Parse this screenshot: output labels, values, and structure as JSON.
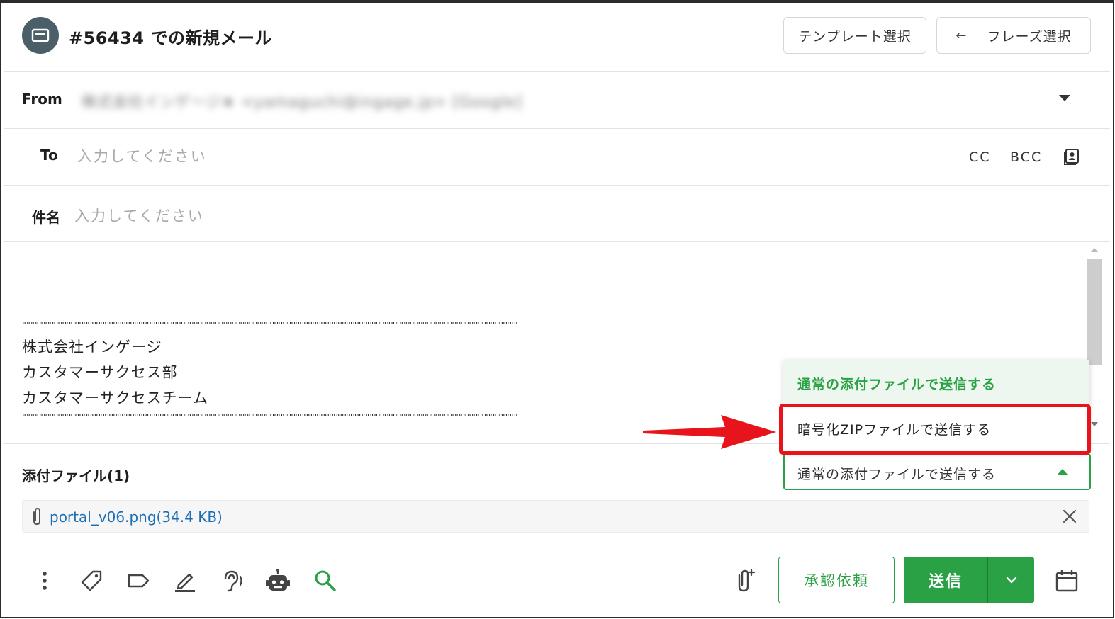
{
  "header": {
    "title": "#56434 での新規メール",
    "template_button": "テンプレート選択",
    "phrase_arrow": "←",
    "phrase_button": "フレーズ選択"
  },
  "from": {
    "label": "From",
    "value": "株式会社インゲージ★ <yamaguchi@ingage.jp> [Google]"
  },
  "to": {
    "label": "To",
    "placeholder": "入力してください",
    "cc": "CC",
    "bcc": "BCC"
  },
  "subject": {
    "label": "件名",
    "placeholder": "入力してください"
  },
  "body": {
    "separator": "\"\"\"\"\"\"\"\"\"\"\"\"\"\"\"\"\"\"\"\"\"\"\"\"\"\"\"\"\"\"\"\"\"\"\"\"\"\"\"\"\"\"\"\"\"\"\"\"\"\"\"\"\"\"\"\"\"\"\"\"\"\"\"\"\"\"\"\"\"\"\"\"\"\"\"\"\"\"\"\"\"\"\"\"\"\"\"\"\"\"\"\"\"\"\"\"\"\"\"\"\"\"\"\"\"\"\"\"\"\"\"\"\"\"\"\"\"\"\"\"\"\"\"\"\"\"\"\"",
    "signature": [
      "株式会社インゲージ",
      "カスタマーサクセス部",
      "カスタマーサクセスチーム"
    ]
  },
  "attachments": {
    "label": "添付ファイル(1)",
    "mode_selected": "通常の添付ファイルで送信する",
    "mode_options": [
      "通常の添付ファイルで送信する",
      "暗号化ZIPファイルで送信する"
    ],
    "file_name": "portal_v06.png(34.4 KB)"
  },
  "footer": {
    "approval_button": "承認依頼",
    "send_button": "送信"
  },
  "colors": {
    "accent_green": "#2aa144",
    "avatar_bg": "#4b5f69",
    "link_blue": "#1c6fb4",
    "highlight_red": "#e8141b"
  },
  "icons": [
    "mail-icon",
    "contacts-icon",
    "paperclip-icon",
    "close-icon",
    "more-vert-icon",
    "tag-icon",
    "label-icon",
    "edit-icon",
    "hearing-icon",
    "robot-icon",
    "search-icon",
    "attach-add-icon",
    "chevron-down-icon",
    "calendar-icon"
  ]
}
